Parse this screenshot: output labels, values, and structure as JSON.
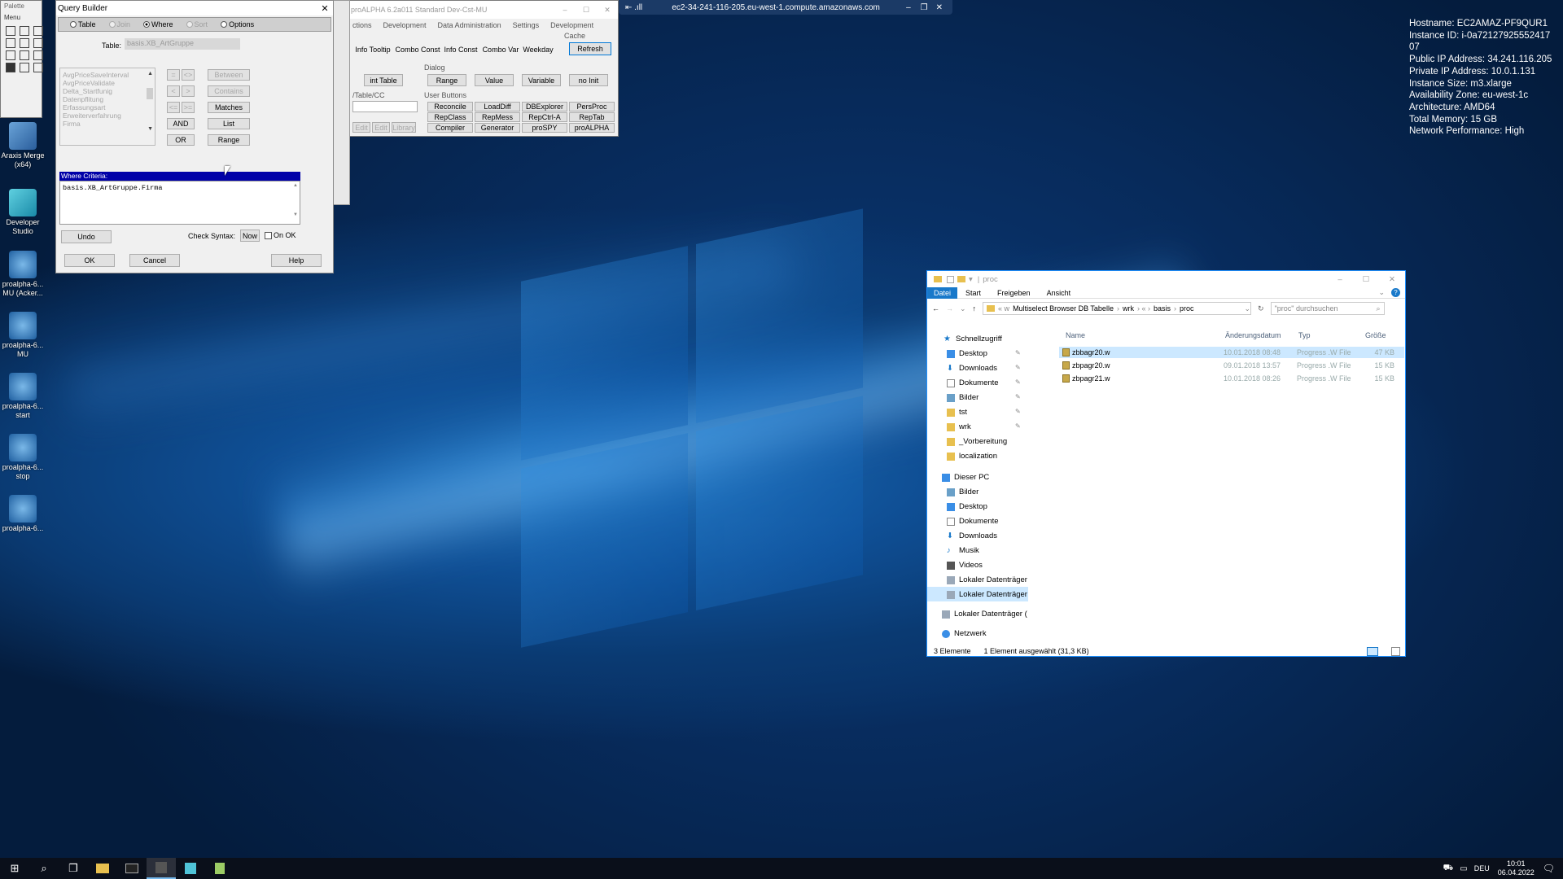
{
  "desktop": {
    "icons": [
      {
        "label": "Araxis Merge (x64)"
      },
      {
        "label": "Developer Studio"
      },
      {
        "label": "proalpha-6... MU (Acker..."
      },
      {
        "label": "proalpha-6... MU"
      },
      {
        "label": "proalpha-6... start"
      },
      {
        "label": "proalpha-6... stop"
      },
      {
        "label": "proalpha-6..."
      }
    ],
    "sysinfo": [
      "Hostname: EC2AMAZ-PF9QUR1",
      "Instance ID: i-0a72127925552417 07",
      "Public IP Address: 34.241.116.205",
      "Private IP Address: 10.0.1.131",
      "Instance Size: m3.xlarge",
      "Availability Zone: eu-west-1c",
      "Architecture: AMD64",
      "Total Memory: 15 GB",
      "Network Performance: High"
    ]
  },
  "rdp_bar": {
    "title": "ec2-34-241-116-205.eu-west-1.compute.amazonaws.com"
  },
  "left_strip": {
    "items": [
      "Palette",
      "Menu"
    ]
  },
  "query_builder": {
    "title": "Query Builder",
    "modes": [
      {
        "label": "Table",
        "checked": false
      },
      {
        "label": "Join",
        "checked": false
      },
      {
        "label": "Where",
        "checked": true
      },
      {
        "label": "Sort",
        "checked": false
      },
      {
        "label": "Options",
        "checked": false
      }
    ],
    "table_label": "Table:",
    "table_value": "basis.XB_ArtGruppe",
    "fields": [
      "AvgPriceSaveInterval",
      "AvgPriceValidate",
      "Delta_Startfunig",
      "Datenpflitung",
      "Erfassungsart",
      "Erweiterverfahrung",
      "Firma"
    ],
    "op_buttons": [
      "AND",
      "OR",
      "Matches",
      "List",
      "Range",
      "Between",
      "Contains"
    ],
    "where_header": "Where Criteria:",
    "where_text": "basis.XB_ArtGruppe.Firma",
    "undo": "Undo",
    "check_syntax": "Check Syntax:",
    "now": "Now",
    "on_ok": "On OK",
    "ok": "OK",
    "cancel": "Cancel",
    "help": "Help"
  },
  "proalpha_window": {
    "title": "proALPHA 6.2a011 Standard Dev-Cst-MU",
    "menu": [
      "ctions",
      "Development",
      "Data Administration",
      "Settings",
      "Development"
    ],
    "row1": [
      "Info Tooltip",
      "Combo Const",
      "Info Const",
      "Combo Var",
      "Weekday"
    ],
    "cache_label": "Cache",
    "refresh": "Refresh",
    "dialog_label": "Dialog",
    "row2": [
      "int Table",
      "Range",
      "Value",
      "Variable",
      "no Init"
    ],
    "table_cc": "/Table/CC",
    "user_buttons": "User Buttons",
    "ub": [
      "Reconcile",
      "LoadDiff",
      "DBExplorer",
      "PersProc",
      "RepClass",
      "RepMess",
      "RepCtrl-A",
      "RepTab",
      "Compiler",
      "Generator",
      "proSPY",
      "proALPHA"
    ],
    "small": [
      "Edit",
      "Edit",
      "Library"
    ]
  },
  "explorer": {
    "title": "proc",
    "ribbon": [
      "Datei",
      "Start",
      "Freigeben",
      "Ansicht"
    ],
    "breadcrumb": [
      "Multiselect Browser DB Tabelle",
      "wrk",
      "basis",
      "proc"
    ],
    "search_placeholder": "\"proc\" durchsuchen",
    "columns": [
      "Name",
      "Änderungsdatum",
      "Typ",
      "Größe"
    ],
    "files": [
      {
        "name": "zbbagr20.w",
        "date": "10.01.2018 08:48",
        "type": "Progress .W File",
        "size": "47 KB",
        "selected": true
      },
      {
        "name": "zbpagr20.w",
        "date": "09.01.2018 13:57",
        "type": "Progress .W File",
        "size": "15 KB",
        "selected": false
      },
      {
        "name": "zbpagr21.w",
        "date": "10.01.2018 08:26",
        "type": "Progress .W File",
        "size": "15 KB",
        "selected": false
      }
    ],
    "nav_quick": [
      {
        "label": "Schnellzugriff",
        "icon": "star-icon",
        "pin": false
      },
      {
        "label": "Desktop",
        "icon": "desktop-icon",
        "pin": true
      },
      {
        "label": "Downloads",
        "icon": "download-icon",
        "pin": true
      },
      {
        "label": "Dokumente",
        "icon": "document-icon",
        "pin": true
      },
      {
        "label": "Bilder",
        "icon": "picture-icon",
        "pin": true
      },
      {
        "label": "tst",
        "icon": "folder-icon",
        "pin": true
      },
      {
        "label": "wrk",
        "icon": "folder-icon",
        "pin": true
      },
      {
        "label": "_Vorbereitung",
        "icon": "folder-icon",
        "pin": false
      },
      {
        "label": "localization",
        "icon": "folder-icon",
        "pin": false
      }
    ],
    "nav_pc": [
      {
        "label": "Dieser PC",
        "icon": "pc-icon"
      },
      {
        "label": "Bilder",
        "icon": "picture-icon"
      },
      {
        "label": "Desktop",
        "icon": "desktop-icon"
      },
      {
        "label": "Dokumente",
        "icon": "document-icon"
      },
      {
        "label": "Downloads",
        "icon": "download-icon"
      },
      {
        "label": "Musik",
        "icon": "music-icon"
      },
      {
        "label": "Videos",
        "icon": "video-icon"
      },
      {
        "label": "Lokaler Datenträger",
        "icon": "drive-icon"
      },
      {
        "label": "Lokaler Datenträger",
        "icon": "drive-icon"
      },
      {
        "label": "Lokaler Datenträger (",
        "icon": "drive-icon"
      },
      {
        "label": "Netzwerk",
        "icon": "network-icon"
      }
    ],
    "status_count": "3 Elemente",
    "status_sel": "1 Element ausgewählt (31,3 KB)"
  },
  "taskbar": {
    "lang": "DEU",
    "time": "10:01",
    "date": "06.04.2022"
  }
}
